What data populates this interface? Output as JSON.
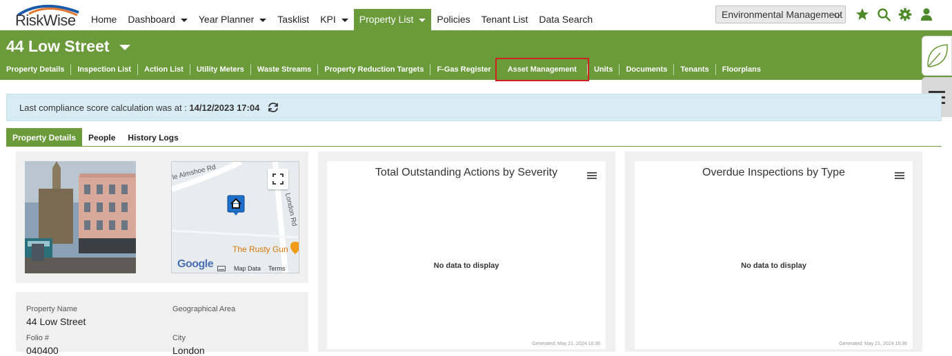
{
  "app": {
    "logo_text": "RiskWise"
  },
  "nav": {
    "items": [
      {
        "label": "Home",
        "has_caret": false,
        "active": false
      },
      {
        "label": "Dashboard",
        "has_caret": true,
        "active": false
      },
      {
        "label": "Year Planner",
        "has_caret": true,
        "active": false
      },
      {
        "label": "Tasklist",
        "has_caret": false,
        "active": false
      },
      {
        "label": "KPI",
        "has_caret": true,
        "active": false
      },
      {
        "label": "Property List",
        "has_caret": true,
        "active": true
      },
      {
        "label": "Policies",
        "has_caret": false,
        "active": false
      },
      {
        "label": "Tenant List",
        "has_caret": false,
        "active": false
      },
      {
        "label": "Data Search",
        "has_caret": false,
        "active": false
      }
    ],
    "module_select": "Environmental Management",
    "icons": [
      "star-icon",
      "search-icon",
      "gear-icon",
      "user-icon"
    ]
  },
  "property": {
    "title": "44 Low Street",
    "subnav": [
      "Property Details",
      "Inspection List",
      "Action List",
      "Utility Meters",
      "Waste Streams",
      "Property Reduction Targets",
      "F-Gas Register",
      "Asset Management",
      "Units",
      "Documents",
      "Tenants",
      "Floorplans"
    ],
    "highlighted_subnav": "Asset Management"
  },
  "info": {
    "text": "Last compliance score calculation was at : ",
    "timestamp": "14/12/2023 17:04"
  },
  "tabs": [
    {
      "label": "Property Details",
      "active": true
    },
    {
      "label": "People",
      "active": false
    },
    {
      "label": "History Logs",
      "active": false
    }
  ],
  "map": {
    "road1": "le Almshoe Rd",
    "road2": "London Rd",
    "poi": "The Rusty Gun",
    "google": "Google",
    "map_data": "Map Data",
    "terms": "Terms"
  },
  "details": {
    "property_name_label": "Property Name",
    "property_name_value": "44 Low Street",
    "geo_area_label": "Geographical Area",
    "geo_area_value": "",
    "folio_label": "Folio #",
    "folio_value": "040400",
    "city_label": "City",
    "city_value": "London"
  },
  "charts": [
    {
      "title": "Total Outstanding Actions by Severity",
      "nodata": "No data to display",
      "generated": "Generated: May 21, 2024 16:36"
    },
    {
      "title": "Overdue Inspections by Type",
      "nodata": "No data to display",
      "generated": "Generated: May 21, 2024 16:36"
    }
  ],
  "colors": {
    "brand_green": "#6a9a3a",
    "info_bg": "#d9ecf4",
    "highlight_red": "#d12020"
  }
}
